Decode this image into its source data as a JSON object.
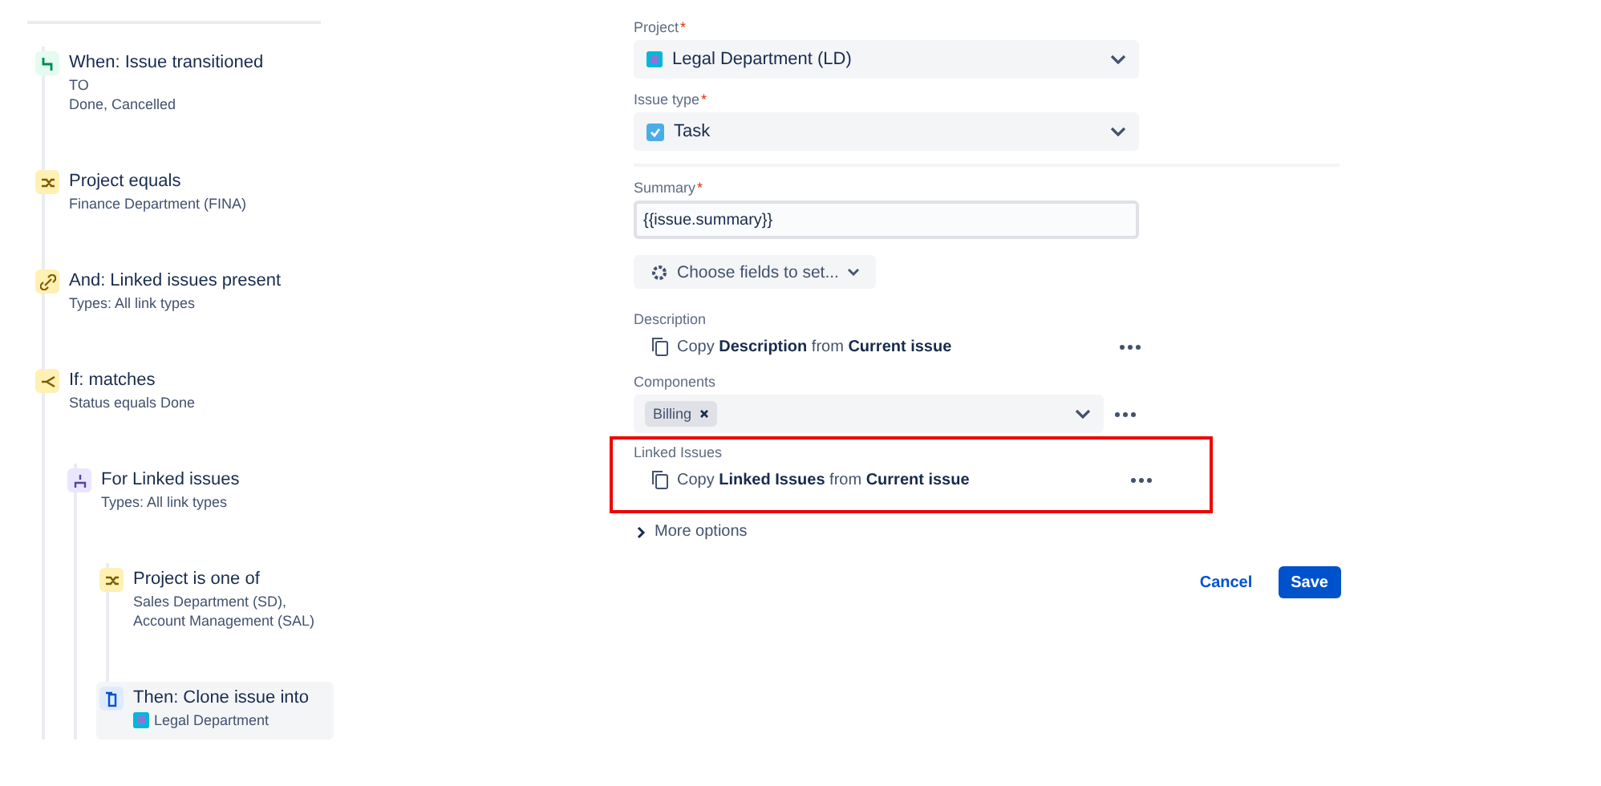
{
  "steps": [
    {
      "kind": "trigger",
      "title": "When: Issue transitioned",
      "details": [
        "TO",
        "Done, Cancelled"
      ],
      "selected": false
    },
    {
      "kind": "condition",
      "title": "Project equals",
      "details": [
        "Finance Department (FINA)"
      ],
      "selected": false
    },
    {
      "kind": "link",
      "title": "And: Linked issues present",
      "details": [
        "Types: All link types"
      ],
      "selected": false
    },
    {
      "kind": "branch",
      "title": "If: matches",
      "details": [
        "Status equals Done"
      ],
      "selected": false,
      "children": [
        {
          "kind": "loop",
          "title": "For Linked issues",
          "details": [
            "Types: All link types"
          ],
          "selected": false,
          "children": [
            {
              "kind": "condition",
              "title": "Project is one of",
              "details": [
                "Sales Department (SD),",
                "Account Management (SAL)"
              ],
              "selected": false
            },
            {
              "kind": "action",
              "title": "Then: Clone issue into",
              "project": "Legal Department",
              "selected": true
            }
          ]
        }
      ]
    }
  ],
  "fields": [
    {
      "kind": "select",
      "label": "Project",
      "required_mark": "*",
      "value": "Legal Department (LD)"
    },
    {
      "kind": "select",
      "label": "Issue type",
      "required_mark": "*",
      "value": "Task"
    },
    {
      "kind": "input",
      "label": "Summary",
      "required_mark": "*",
      "value": "{{issue.summary}}"
    },
    {
      "kind": "button",
      "text": "Choose fields to set..."
    },
    {
      "kind": "copy",
      "label": "Description",
      "text": "Copy **Description** from **Current issue**",
      "highlighted": false
    },
    {
      "kind": "multiselect",
      "label": "Components",
      "tags": [
        "Billing"
      ]
    },
    {
      "kind": "copy",
      "label": "Linked Issues",
      "text": "Copy **Linked Issues** from **Current issue**",
      "highlighted": true
    }
  ],
  "more_options": "More options",
  "buttons": [
    {
      "kind": "secondary",
      "label": "Cancel"
    },
    {
      "kind": "primary",
      "label": "Save"
    }
  ]
}
